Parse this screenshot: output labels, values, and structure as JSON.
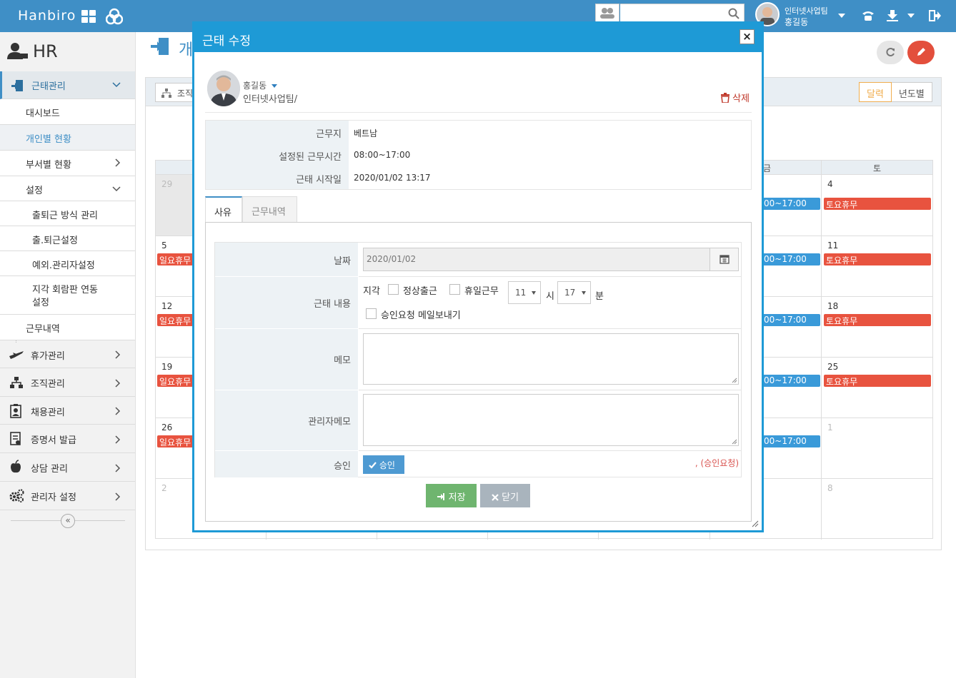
{
  "topbar": {
    "brand": "Hanbiro",
    "search_placeholder": "",
    "user_dept": "인터넷사업팀",
    "user_name": "홍길동"
  },
  "sidebar": {
    "title": "HR",
    "groups": [
      {
        "label": "근태관리"
      },
      {
        "label": "휴가관리"
      },
      {
        "label": "조직관리"
      },
      {
        "label": "채용관리"
      },
      {
        "label": "증명서 발급"
      },
      {
        "label": "상담 관리"
      },
      {
        "label": "관리자 설정"
      }
    ],
    "sub": [
      "대시보드",
      "개인별 현황",
      "부서별 현황",
      "설정",
      "근무내역"
    ],
    "settings_sub": [
      "출퇴근 방식 관리",
      "출.퇴근설정",
      "예외.관리자설정",
      "지각 회람판 연동",
      "설정"
    ]
  },
  "main": {
    "title_partial": "개",
    "org_button": "조직",
    "view_month": "달력",
    "view_year": "년도별",
    "cal_head_fri": "금",
    "cal_head_sat": "토",
    "days": [
      "29",
      "4",
      "5",
      "11",
      "12",
      "18",
      "19",
      "25",
      "26",
      "1",
      "2",
      "8"
    ],
    "ev_sun": "일요휴무",
    "ev_sat": "토요휴무",
    "ev_time": "00~17:00"
  },
  "modal": {
    "title": "근태 수정",
    "close": "×",
    "user_name": "홍길동",
    "user_dept": "인터넷사업팀/",
    "delete_label": "삭제",
    "info": [
      {
        "k": "근무지",
        "v": "베트남"
      },
      {
        "k": "설정된 근무시간",
        "v": "08:00~17:00"
      },
      {
        "k": "근태 시작일",
        "v": "2020/01/02 13:17"
      }
    ],
    "tabs": [
      "사유",
      "근무내역"
    ],
    "form": {
      "date_label": "날짜",
      "date_value": "2020/01/02",
      "content_label": "근태 내용",
      "late": "지각",
      "normal": "정상출근",
      "holiday_work": "휴일근무",
      "hour": "11",
      "hour_unit": "시",
      "minute": "17",
      "minute_unit": "분",
      "mail": "승인요청 메일보내기",
      "memo_label": "메모",
      "admin_memo_label": "관리자메모",
      "approve_label": "승인",
      "approve_btn": "승인",
      "approve_status": ", (승인요청)"
    },
    "save": "저장",
    "close_btn": "닫기"
  },
  "colors": {
    "topbar": "#3f8fc6",
    "modal_header": "#1e9ad6",
    "save": "#6fb56f",
    "close": "#a9b4bd",
    "red_event": "#e8533f",
    "blue_event": "#3a9ad9"
  }
}
